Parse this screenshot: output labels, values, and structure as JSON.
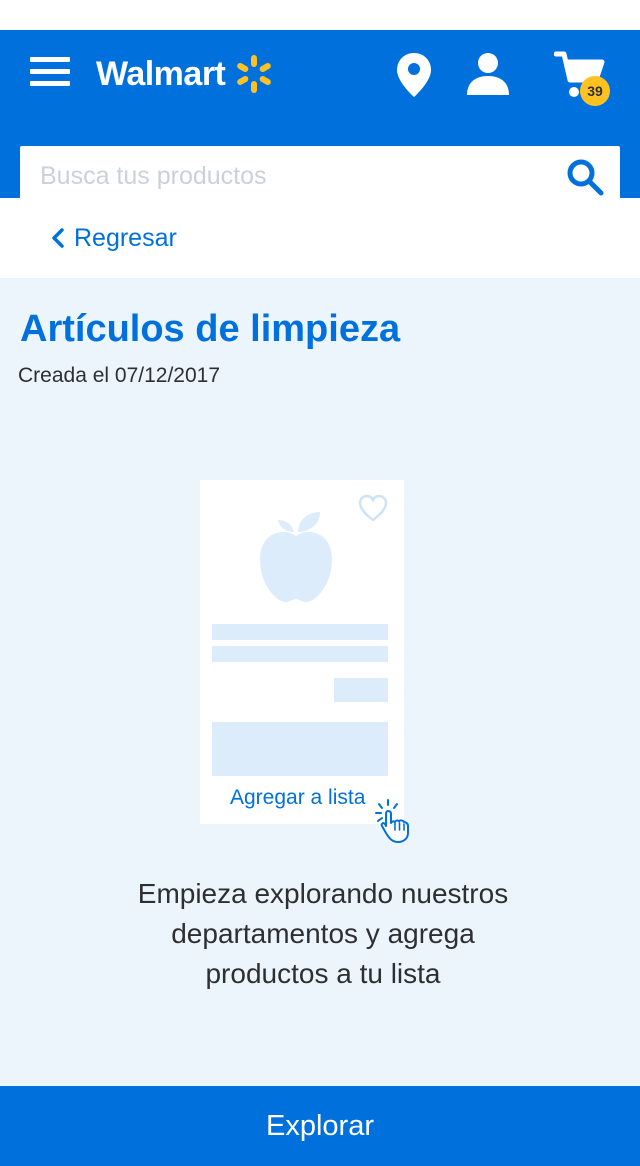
{
  "header": {
    "logo_text": "Walmart",
    "brand_color": "#0071dc",
    "spark_color": "#ffc220",
    "icons": [
      "menu-icon",
      "location-pin-icon",
      "account-icon",
      "cart-icon"
    ],
    "cart_count": "39",
    "search": {
      "placeholder": "Busca tus productos",
      "value": ""
    }
  },
  "nav": {
    "back_label": "Regresar"
  },
  "list": {
    "title": "Artículos de limpieza",
    "created": "Creada el 07/12/2017"
  },
  "illustration": {
    "add_label": "Agregar a lista",
    "skeleton_color": "#dcecfb"
  },
  "empty_state": {
    "line1": "Empieza explorando nuestros",
    "line2": "departamentos y agrega",
    "line3": "productos a tu lista"
  },
  "footer": {
    "explore_label": "Explorar"
  }
}
